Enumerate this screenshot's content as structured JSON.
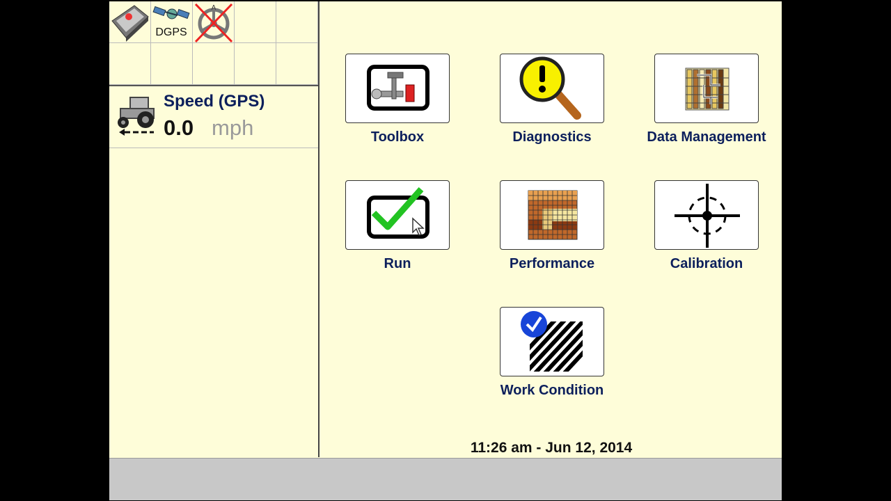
{
  "status_bar": {
    "dgps_label": "DGPS"
  },
  "speed": {
    "label": "Speed (GPS)",
    "value": "0.0",
    "unit": "mph"
  },
  "menu": {
    "toolbox": "Toolbox",
    "diagnostics": "Diagnostics",
    "data_management": "Data Management",
    "run": "Run",
    "performance": "Performance",
    "calibration": "Calibration",
    "work_condition": "Work Condition"
  },
  "datetime": "11:26 am - Jun 12, 2014",
  "colors": {
    "background": "#fefdd9",
    "label_blue": "#0c1f5c",
    "check_green": "#22c322"
  }
}
